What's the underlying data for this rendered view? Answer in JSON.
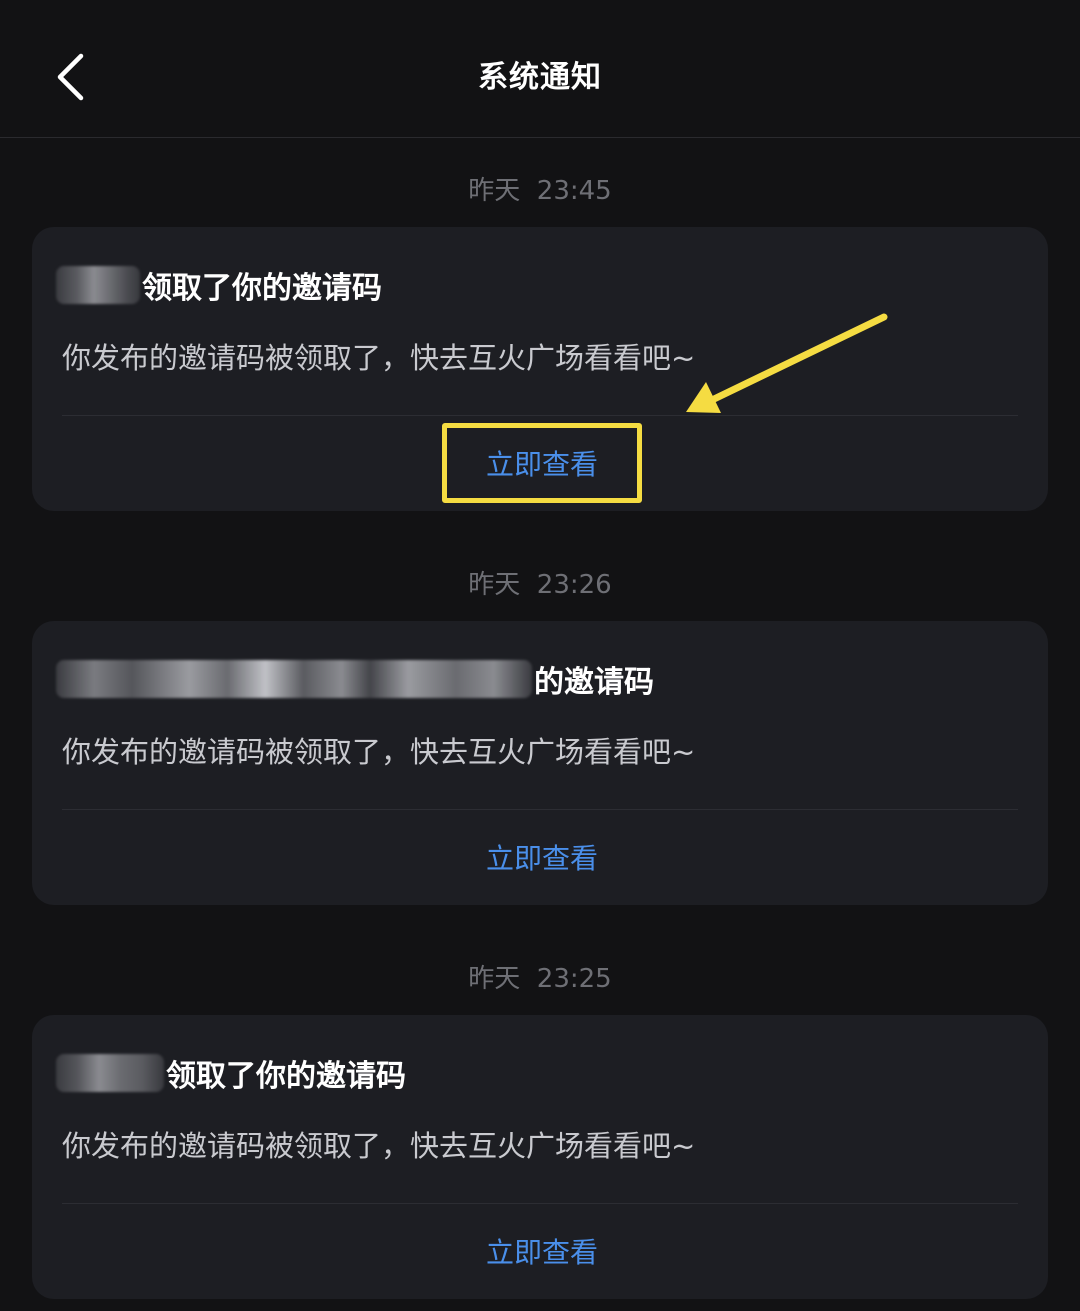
{
  "header": {
    "title": "系统通知",
    "back_icon": "chevron-left-icon"
  },
  "notifications": [
    {
      "time": "昨天  23:45",
      "title_text": "领取了你的邀请码",
      "body": "你发布的邀请码被领取了，快去互火广场看看吧~",
      "action_label": "立即查看",
      "highlighted": true
    },
    {
      "time": "昨天  23:26",
      "title_text": "的邀请码",
      "body": "你发布的邀请码被领取了，快去互火广场看看吧~",
      "action_label": "立即查看",
      "highlighted": false
    },
    {
      "time": "昨天  23:25",
      "title_text": "领取了你的邀请码",
      "body": "你发布的邀请码被领取了，快去互火广场看看吧~",
      "action_label": "立即查看",
      "highlighted": false
    }
  ],
  "annotation": {
    "arrow_color": "#f5dc42",
    "highlight_color": "#f5dc42"
  },
  "colors": {
    "background": "#121214",
    "card": "#1d1e23",
    "link": "#4a8fea",
    "muted_text": "#6e6f75"
  }
}
